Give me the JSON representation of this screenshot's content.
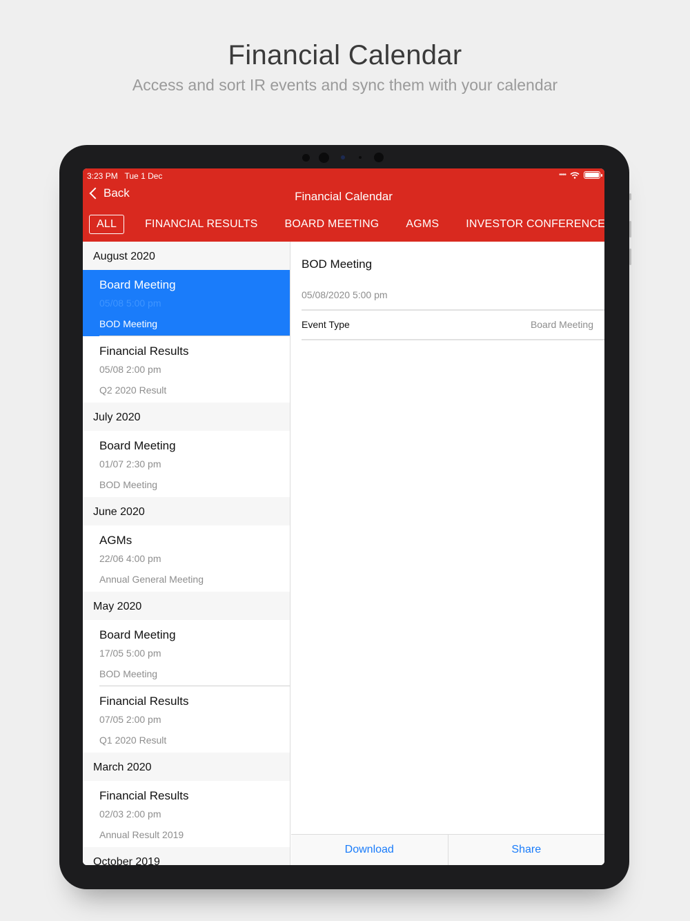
{
  "promo": {
    "title": "Financial Calendar",
    "subtitle": "Access and sort IR events and sync them with your calendar"
  },
  "status": {
    "time": "3:23 PM",
    "date": "Tue 1 Dec"
  },
  "nav": {
    "back_label": "Back",
    "title": "Financial Calendar"
  },
  "filters": [
    "ALL",
    "FINANCIAL RESULTS",
    "BOARD MEETING",
    "AGMS",
    "INVESTOR CONFERENCE"
  ],
  "active_filter": "ALL",
  "sections": [
    {
      "month": "August 2020",
      "events": [
        {
          "title": "Board Meeting",
          "time": "05/08 5:00 pm",
          "desc": "BOD Meeting",
          "selected": true
        },
        {
          "title": "Financial Results",
          "time": "05/08 2:00 pm",
          "desc": "Q2 2020 Result"
        }
      ]
    },
    {
      "month": "July 2020",
      "events": [
        {
          "title": "Board Meeting",
          "time": "01/07 2:30 pm",
          "desc": "BOD Meeting"
        }
      ]
    },
    {
      "month": "June 2020",
      "events": [
        {
          "title": "AGMs",
          "time": "22/06 4:00 pm",
          "desc": "Annual General Meeting"
        }
      ]
    },
    {
      "month": "May 2020",
      "events": [
        {
          "title": "Board Meeting",
          "time": "17/05 5:00 pm",
          "desc": "BOD Meeting"
        },
        {
          "title": "Financial Results",
          "time": "07/05 2:00 pm",
          "desc": "Q1 2020 Result"
        }
      ]
    },
    {
      "month": "March 2020",
      "events": [
        {
          "title": "Financial Results",
          "time": "02/03 2:00 pm",
          "desc": "Annual Result 2019"
        }
      ]
    },
    {
      "month": "October 2019",
      "events": []
    }
  ],
  "detail": {
    "title": "BOD Meeting",
    "datetime": "05/08/2020 5:00 pm",
    "event_type_label": "Event Type",
    "event_type_value": "Board Meeting"
  },
  "actions": {
    "download": "Download",
    "share": "Share"
  },
  "colors": {
    "brand_red": "#d9291f",
    "selected_blue": "#1a7cfa"
  }
}
